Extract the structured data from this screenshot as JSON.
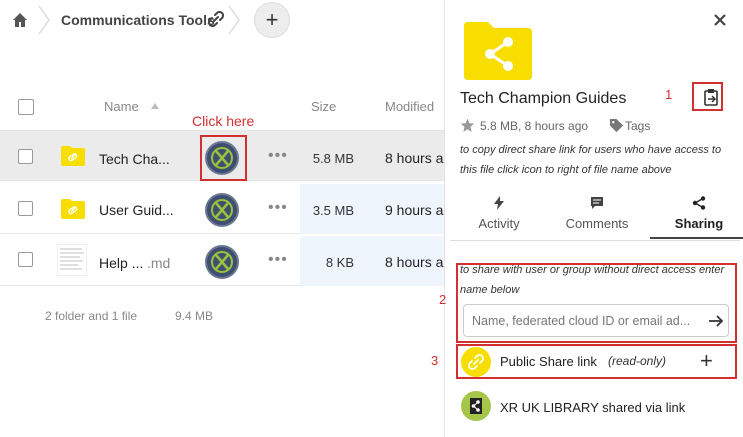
{
  "breadcrumb": {
    "home_icon": "home-icon",
    "folder": "Communications Tools"
  },
  "columns": {
    "name": "Name",
    "size": "Size",
    "modified": "Modified"
  },
  "annotation_click_here": "Click here",
  "files": [
    {
      "name": "Tech Cha...",
      "size": "5.8 MB",
      "modified": "8 hours ago"
    },
    {
      "name": "User Guid...",
      "size": "3.5 MB",
      "modified": "9 hours ago"
    },
    {
      "name": "Help ...",
      "ext": ".md",
      "size": "8 KB",
      "modified": "8 hours ago"
    }
  ],
  "summary": {
    "counts": "2 folder and 1 file",
    "total_size": "9.4 MB"
  },
  "sidebar": {
    "title": "Tech Champion Guides",
    "meta": "5.8 MB, 8 hours ago",
    "tags_label": "Tags",
    "hint_copy_link": "to copy direct share link for users who have access to this file click icon to right of file name above",
    "tabs": [
      {
        "label": "Activity",
        "icon": "lightning-icon"
      },
      {
        "label": "Comments",
        "icon": "comment-icon"
      },
      {
        "label": "Sharing",
        "icon": "share-icon"
      }
    ],
    "hint_share_user": "to share with user or group without direct access enter name below",
    "share_input_placeholder": "Name, federated cloud ID or email ad...",
    "public_link_label": "Public Share link",
    "public_link_note": "(read-only)",
    "library_label": "XR UK LIBRARY shared via link"
  },
  "annotations": {
    "n1": "1",
    "n2": "2",
    "n3": "3"
  },
  "colors": {
    "folder_yellow": "#f7de00",
    "annotation_red": "#d32f2f",
    "size_highlight": "#eef5fd",
    "library_green": "#a6c64a"
  }
}
